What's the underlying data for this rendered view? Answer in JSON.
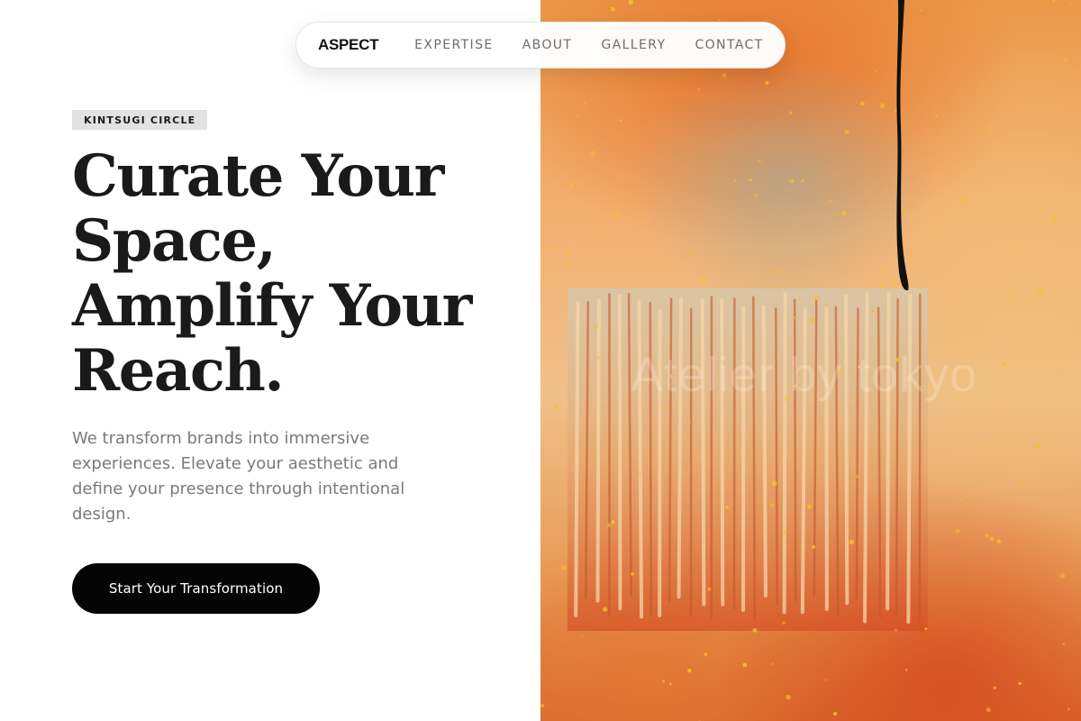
{
  "nav": {
    "brand": "ASPECT",
    "links": [
      "EXPERTISE",
      "ABOUT",
      "GALLERY",
      "CONTACT"
    ]
  },
  "hero": {
    "badge": "KINTSUGI CIRCLE",
    "headline_lines": [
      "Curate Your",
      "Space,",
      "Amplify Your",
      "Reach."
    ],
    "subtext": "We transform brands into immersive experiences. Elevate your aesthetic and define your presence through intentional design.",
    "cta_label": "Start Your Transformation"
  },
  "artwork": {
    "watermark": "Atelier by tokyo",
    "description_icon": "abstract-textured-painting",
    "colors": {
      "orange": "#e8863a",
      "peach": "#f2be88",
      "red": "#d24a22",
      "slate": "#9fb1ad",
      "stroke": "#111111"
    }
  },
  "theme": {
    "background": "#ffffff",
    "text_dark": "#1a1a1a",
    "text_muted": "#7a7a7a",
    "badge_bg": "#e2e2e2",
    "cta_bg": "#050505"
  }
}
